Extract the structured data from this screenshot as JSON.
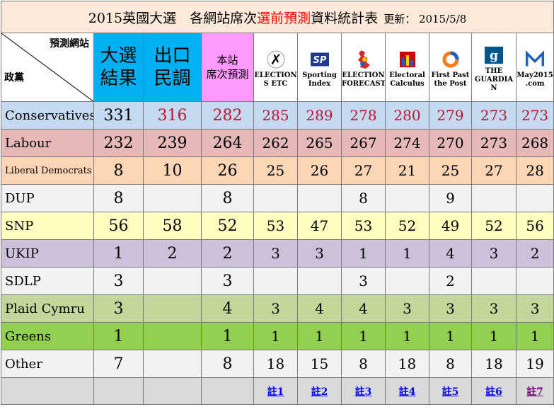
{
  "title": {
    "pre": "2015英國大選　各網站席次",
    "highlight": "選前預測",
    "post": "資料統計表",
    "update": "更新：  2015/5/8"
  },
  "header": {
    "diag_top": "預測網站",
    "diag_bottom": "政黨",
    "result": "大選\n結果",
    "exit_poll": "出口\n民調",
    "own_forecast": "本站\n席次預測",
    "sites": [
      {
        "label": "ELECTION\nS ETC",
        "icon": "election-etc-cross-icon"
      },
      {
        "label": "Sporting\nIndex",
        "icon": "sporting-index-sp-icon"
      },
      {
        "label": "ELECTION\nFORECAST",
        "icon": "election-forecast-map-icon"
      },
      {
        "label": "Electoral\nCalculus",
        "icon": "electoral-calculus-icon"
      },
      {
        "label": "First Past\nthe Post",
        "icon": "first-past-the-post-ring-icon"
      },
      {
        "label": "THE\nGUARDIA\nN",
        "icon": "guardian-g-icon"
      },
      {
        "label": "May2015\n.com",
        "icon": "may2015-m-icon"
      }
    ]
  },
  "rows": [
    {
      "party": "Conservatives",
      "bg": "#c5d9f1",
      "result": "331",
      "exit": "316",
      "own": "282",
      "sites": [
        "285",
        "289",
        "278",
        "280",
        "279",
        "273",
        "273"
      ],
      "red": true
    },
    {
      "party": "Labour",
      "bg": "#e6b9b8",
      "result": "232",
      "exit": "239",
      "own": "264",
      "sites": [
        "262",
        "265",
        "267",
        "274",
        "270",
        "273",
        "268"
      ],
      "red": false
    },
    {
      "party": "Liberal Democrats",
      "bg": "#fcd5b4",
      "result": "8",
      "exit": "10",
      "own": "26",
      "sites": [
        "25",
        "26",
        "27",
        "21",
        "25",
        "27",
        "28"
      ],
      "red": false,
      "small": true
    },
    {
      "party": "DUP",
      "bg": "#f2f2f2",
      "result": "8",
      "exit": "",
      "own": "8",
      "sites": [
        "",
        "",
        "8",
        "",
        "9",
        "",
        ""
      ],
      "red": false
    },
    {
      "party": "SNP",
      "bg": "#ffffc0",
      "result": "56",
      "exit": "58",
      "own": "52",
      "sites": [
        "53",
        "47",
        "53",
        "52",
        "49",
        "52",
        "56"
      ],
      "red": false
    },
    {
      "party": "UKIP",
      "bg": "#ccc0da",
      "result": "1",
      "exit": "2",
      "own": "2",
      "sites": [
        "3",
        "3",
        "1",
        "1",
        "4",
        "3",
        "2"
      ],
      "red": false
    },
    {
      "party": "SDLP",
      "bg": "#f2f2f2",
      "result": "3",
      "exit": "",
      "own": "3",
      "sites": [
        "",
        "",
        "3",
        "",
        "2",
        "",
        ""
      ],
      "red": false
    },
    {
      "party": "Plaid Cymru",
      "bg": "#c4d79b",
      "result": "3",
      "exit": "",
      "own": "4",
      "sites": [
        "3",
        "4",
        "4",
        "3",
        "3",
        "3",
        "3"
      ],
      "red": false
    },
    {
      "party": "Greens",
      "bg": "#92d050",
      "result": "1",
      "exit": "",
      "own": "1",
      "sites": [
        "1",
        "1",
        "1",
        "1",
        "1",
        "1",
        "1"
      ],
      "red": false
    },
    {
      "party": "Other",
      "bg": "#f2f2f2",
      "result": "7",
      "exit": "",
      "own": "8",
      "sites": [
        "18",
        "15",
        "8",
        "18",
        "8",
        "18",
        "19"
      ],
      "red": false
    }
  ],
  "notes": [
    "註1",
    "註2",
    "註3",
    "註4",
    "註5",
    "註6",
    "註7"
  ]
}
